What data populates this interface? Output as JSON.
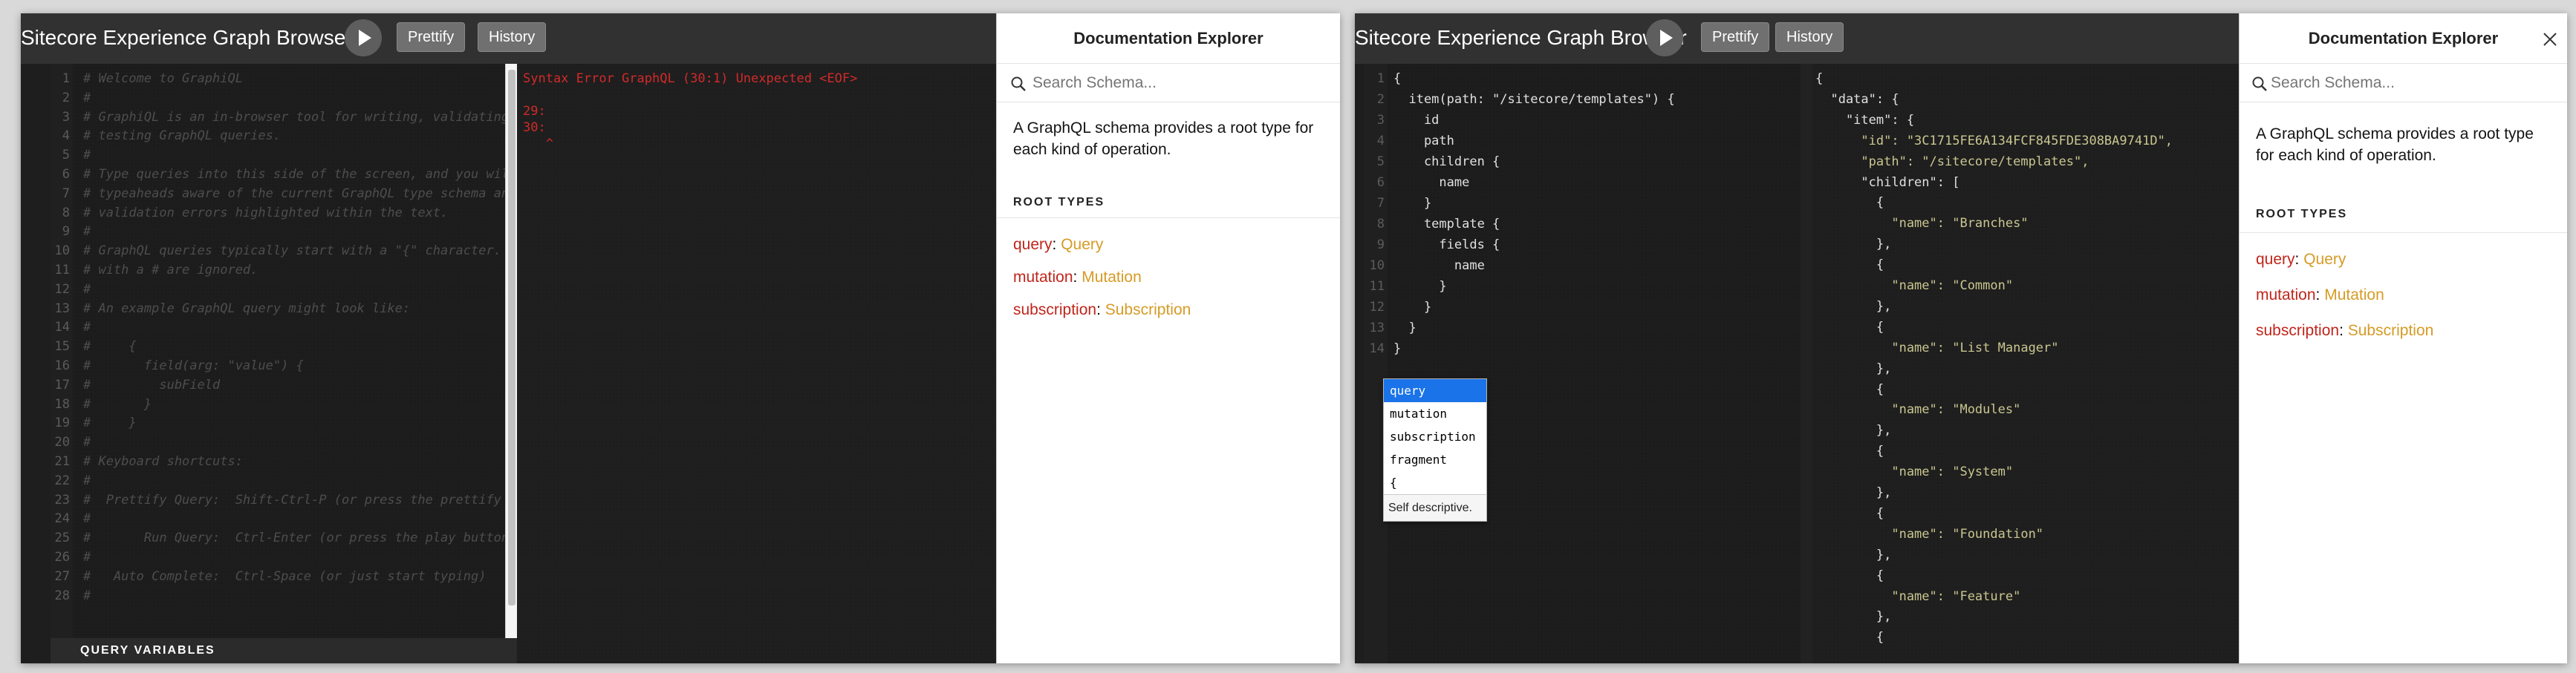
{
  "left": {
    "title": "Sitecore Experience Graph Browser",
    "prettify_label": "Prettify",
    "history_label": "History",
    "query_variables_label": "QUERY VARIABLES",
    "query_lines": [
      {
        "n": "1",
        "text": "# Welcome to GraphiQL"
      },
      {
        "n": "2",
        "text": "#"
      },
      {
        "n": "3",
        "text": "# GraphiQL is an in-browser tool for writing, validating, and"
      },
      {
        "n": "4",
        "text": "# testing GraphQL queries."
      },
      {
        "n": "5",
        "text": "#"
      },
      {
        "n": "6",
        "text": "# Type queries into this side of the screen, and you will see intelligent"
      },
      {
        "n": "7",
        "text": "# typeaheads aware of the current GraphQL type schema and live syntax and"
      },
      {
        "n": "8",
        "text": "# validation errors highlighted within the text."
      },
      {
        "n": "9",
        "text": "#"
      },
      {
        "n": "10",
        "text": "# GraphQL queries typically start with a \"{\" character. Lines that start"
      },
      {
        "n": "11",
        "text": "# with a # are ignored."
      },
      {
        "n": "12",
        "text": "#"
      },
      {
        "n": "13",
        "text": "# An example GraphQL query might look like:"
      },
      {
        "n": "14",
        "text": "#"
      },
      {
        "n": "15",
        "text": "#     {"
      },
      {
        "n": "16",
        "text": "#       field(arg: \"value\") {"
      },
      {
        "n": "17",
        "text": "#         subField"
      },
      {
        "n": "18",
        "text": "#       }"
      },
      {
        "n": "19",
        "text": "#     }"
      },
      {
        "n": "20",
        "text": "#"
      },
      {
        "n": "21",
        "text": "# Keyboard shortcuts:"
      },
      {
        "n": "22",
        "text": "#"
      },
      {
        "n": "23",
        "text": "#  Prettify Query:  Shift-Ctrl-P (or press the prettify button above)"
      },
      {
        "n": "24",
        "text": "#"
      },
      {
        "n": "25",
        "text": "#       Run Query:  Ctrl-Enter (or press the play button above)"
      },
      {
        "n": "26",
        "text": "#"
      },
      {
        "n": "27",
        "text": "#   Auto Complete:  Ctrl-Space (or just start typing)"
      },
      {
        "n": "28",
        "text": "#"
      }
    ],
    "result_lines": [
      {
        "text": "Syntax Error GraphQL (30:1) Unexpected <EOF>"
      },
      {
        "text": ""
      },
      {
        "text": "29:"
      },
      {
        "text": "30:"
      },
      {
        "text": "   ^"
      }
    ]
  },
  "right": {
    "title": "Sitecore Experience Graph Browser",
    "prettify_label": "Prettify",
    "history_label": "History",
    "query_lines": [
      {
        "n": "1",
        "text": "{"
      },
      {
        "n": "2",
        "text": "  item(path: \"/sitecore/templates\") {"
      },
      {
        "n": "3",
        "text": "    id"
      },
      {
        "n": "4",
        "text": "    path"
      },
      {
        "n": "5",
        "text": "    children {"
      },
      {
        "n": "6",
        "text": "      name"
      },
      {
        "n": "7",
        "text": "    }"
      },
      {
        "n": "8",
        "text": "    template {"
      },
      {
        "n": "9",
        "text": "      fields {"
      },
      {
        "n": "10",
        "text": "        name"
      },
      {
        "n": "11",
        "text": "      }"
      },
      {
        "n": "12",
        "text": "    }"
      },
      {
        "n": "13",
        "text": "  }"
      },
      {
        "n": "14",
        "text": "}"
      }
    ],
    "result_lines": [
      {
        "text": "{"
      },
      {
        "text": "  \"data\": {"
      },
      {
        "text": "    \"item\": {"
      },
      {
        "text": "      \"id\": \"3C1715FE6A134FCF845FDE308BA9741D\","
      },
      {
        "text": "      \"path\": \"/sitecore/templates\","
      },
      {
        "text": "      \"children\": ["
      },
      {
        "text": "        {"
      },
      {
        "text": "          \"name\": \"Branches\""
      },
      {
        "text": "        },"
      },
      {
        "text": "        {"
      },
      {
        "text": "          \"name\": \"Common\""
      },
      {
        "text": "        },"
      },
      {
        "text": "        {"
      },
      {
        "text": "          \"name\": \"List Manager\""
      },
      {
        "text": "        },"
      },
      {
        "text": "        {"
      },
      {
        "text": "          \"name\": \"Modules\""
      },
      {
        "text": "        },"
      },
      {
        "text": "        {"
      },
      {
        "text": "          \"name\": \"System\""
      },
      {
        "text": "        },"
      },
      {
        "text": "        {"
      },
      {
        "text": "          \"name\": \"Foundation\""
      },
      {
        "text": "        },"
      },
      {
        "text": "        {"
      },
      {
        "text": "          \"name\": \"Feature\""
      },
      {
        "text": "        },"
      },
      {
        "text": "        {"
      }
    ],
    "autocomplete": {
      "items": [
        "query",
        "mutation",
        "subscription",
        "fragment",
        "{"
      ],
      "selected": "query",
      "info": "Self descriptive."
    }
  },
  "docs": {
    "title": "Documentation Explorer",
    "search_placeholder": "Search Schema...",
    "description": "A GraphQL schema provides a root type for each kind of operation.",
    "root_types_label": "ROOT TYPES",
    "fields": [
      {
        "name": "query",
        "type": "Query"
      },
      {
        "name": "mutation",
        "type": "Mutation"
      },
      {
        "name": "subscription",
        "type": "Subscription"
      }
    ],
    "close_icon": "close-icon",
    "search_icon": "search-icon"
  },
  "colors": {
    "field_name": "#c0251b",
    "field_type": "#d69b25",
    "error": "#d12a2a",
    "string": "#c9c690",
    "selection": "#1a73e8"
  }
}
